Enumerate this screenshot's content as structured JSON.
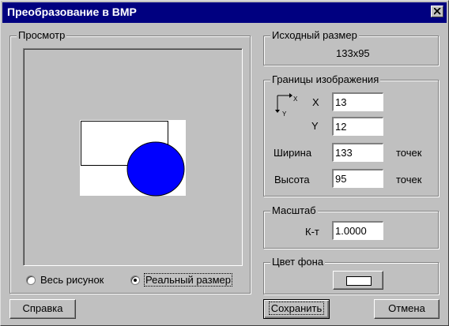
{
  "window": {
    "title": "Преобразование в BMP"
  },
  "preview": {
    "group_label": "Просмотр",
    "radio_all": "Весь рисунок",
    "radio_real": "Реальный размер",
    "selected": "real",
    "circle_color": "#0000ff"
  },
  "source_size": {
    "group_label": "Исходный размер",
    "value": "133x95"
  },
  "bounds": {
    "group_label": "Границы изображения",
    "axis_x": "X",
    "axis_y": "Y",
    "x_label": "X",
    "x_value": "13",
    "y_label": "Y",
    "y_value": "12",
    "width_label": "Ширина",
    "width_value": "133",
    "width_unit": "точек",
    "height_label": "Высота",
    "height_value": "95",
    "height_unit": "точек"
  },
  "scale": {
    "group_label": "Масштаб",
    "coef_label": "К-т",
    "coef_value": "1.0000"
  },
  "bg_color": {
    "group_label": "Цвет фона",
    "color": "#ffffff"
  },
  "buttons": {
    "help": "Справка",
    "save": "Сохранить",
    "cancel": "Отмена"
  }
}
